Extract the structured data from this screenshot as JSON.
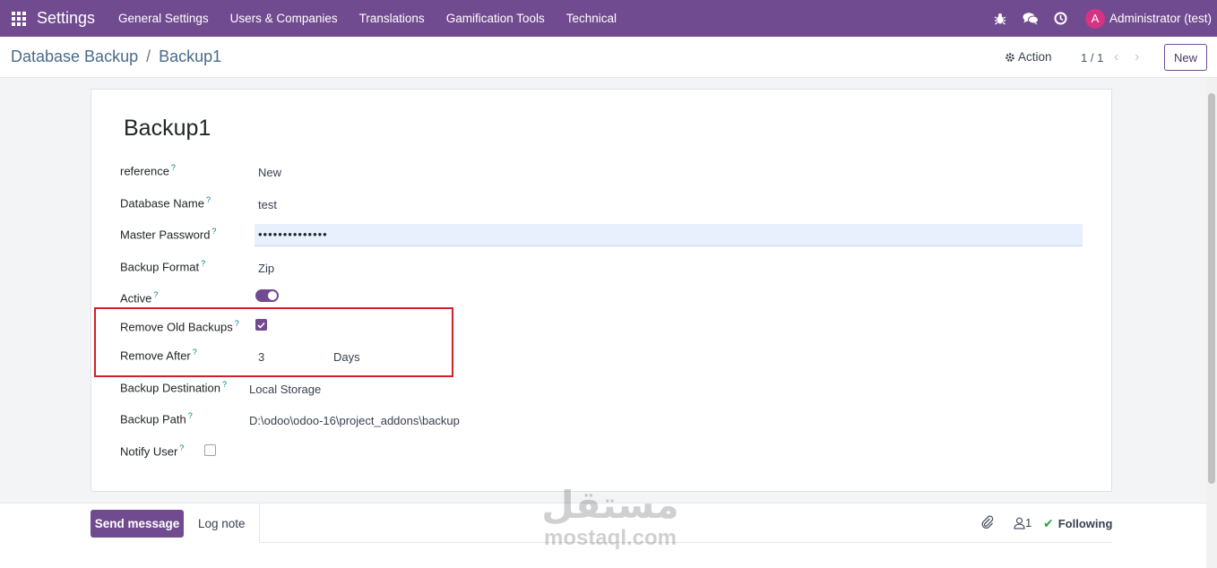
{
  "navbar": {
    "brand": "Settings",
    "menu": [
      "General Settings",
      "Users & Companies",
      "Translations",
      "Gamification Tools",
      "Technical"
    ],
    "user_initial": "A",
    "user_name": "Administrator (test)",
    "icons": [
      "apps-grid-icon",
      "bug-icon",
      "chat-icon",
      "clock-icon"
    ],
    "color": "#714b8f"
  },
  "control": {
    "breadcrumb_parent": "Database Backup",
    "breadcrumb_sep": "/",
    "breadcrumb_current": "Backup1",
    "action_label": "Action",
    "pager": "1 / 1",
    "new_label": "New"
  },
  "form": {
    "title": "Backup1",
    "help_mark": "?",
    "fields": {
      "reference": {
        "label": "reference",
        "value": "New"
      },
      "database_name": {
        "label": "Database Name",
        "value": "test"
      },
      "master_password": {
        "label": "Master Password",
        "value": "••••••••••••••"
      },
      "backup_format": {
        "label": "Backup Format",
        "value": "Zip"
      },
      "active": {
        "label": "Active",
        "value": true
      },
      "remove_old_backups": {
        "label": "Remove Old Backups",
        "value": true
      },
      "remove_after": {
        "label": "Remove After",
        "value": "3",
        "unit": "Days"
      },
      "backup_destination": {
        "label": "Backup Destination",
        "value": "Local Storage"
      },
      "backup_path": {
        "label": "Backup Path",
        "value": "D:\\odoo\\odoo-16\\project_addons\\backup"
      },
      "notify_user": {
        "label": "Notify User",
        "value": false
      }
    },
    "highlight_color": "#d0202a"
  },
  "chatter": {
    "send_message": "Send message",
    "log_note": "Log note",
    "followers_count": "1",
    "following_label": "Following"
  },
  "watermark": {
    "arabic": "مستقل",
    "latin": "mostaql.com"
  }
}
